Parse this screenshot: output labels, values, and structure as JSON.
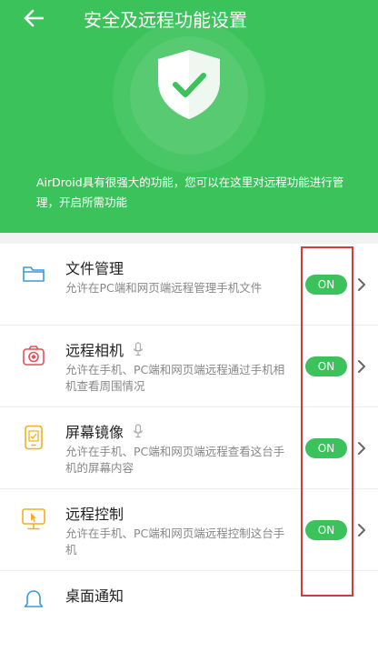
{
  "header": {
    "title": "安全及远程功能设置",
    "description": "AirDroid具有很强大的功能，您可以在这里对远程功能进行管理，开启所需功能",
    "bg_color": "#3cc25b"
  },
  "icons": {
    "back": "arrow-left-icon",
    "shield": "shield-check-icon"
  },
  "features": [
    {
      "title": "文件管理",
      "subtitle": "允许在PC端和网页端远程管理手机文件",
      "toggle": "ON",
      "icon": "folder-icon",
      "mic": false
    },
    {
      "title": "远程相机",
      "subtitle": "允许在手机、PC端和网页端远程通过手机相机查看周围情况",
      "toggle": "ON",
      "icon": "camera-icon",
      "mic": true
    },
    {
      "title": "屏幕镜像",
      "subtitle": "允许在手机、PC端和网页端远程查看这台手机的屏幕内容",
      "toggle": "ON",
      "icon": "phone-mirror-icon",
      "mic": true
    },
    {
      "title": "远程控制",
      "subtitle": "允许在手机、PC端和网页端远程控制这台手机",
      "toggle": "ON",
      "icon": "monitor-cursor-icon",
      "mic": false
    },
    {
      "title": "桌面通知",
      "subtitle": "",
      "toggle": "",
      "icon": "bell-icon",
      "mic": false
    }
  ],
  "colors": {
    "accent": "#3cc25b",
    "highlight": "#d43b3b"
  }
}
